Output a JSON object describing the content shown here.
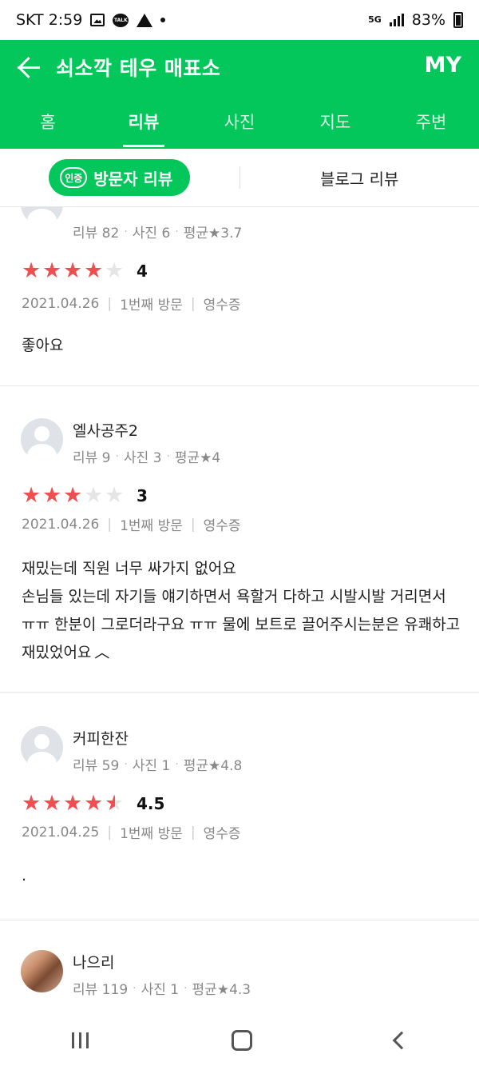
{
  "status": {
    "carrier_time": "SKT 2:59",
    "network": "5G",
    "battery": "83%"
  },
  "appbar": {
    "title": "쇠소깍 테우 매표소",
    "my_label": "MY"
  },
  "tabs": [
    {
      "label": "홈"
    },
    {
      "label": "리뷰"
    },
    {
      "label": "사진"
    },
    {
      "label": "지도"
    },
    {
      "label": "주변"
    }
  ],
  "subtabs": {
    "badge": "인증",
    "visitor": "방문자 리뷰",
    "blog": "블로그 리뷰"
  },
  "reviews": [
    {
      "name": "",
      "meta": {
        "reviews": "리뷰 82",
        "photos": "사진 6",
        "avg": "평균★3.7"
      },
      "rating": 4,
      "score": "4",
      "visit": {
        "date": "2021.04.26",
        "count": "1번째 방문",
        "type": "영수증"
      },
      "content": "좋아요"
    },
    {
      "name": "엘사공주2",
      "meta": {
        "reviews": "리뷰 9",
        "photos": "사진 3",
        "avg": "평균★4"
      },
      "rating": 3,
      "score": "3",
      "visit": {
        "date": "2021.04.26",
        "count": "1번째 방문",
        "type": "영수증"
      },
      "content": "재밌는데 직원 너무 싸가지 없어요\n손님들 있는데 자기들 얘기하면서 욕할거 다하고 시발시발 거리면서 ㅠㅠ 한분이 그로더라구요 ㅠㅠ 물에 보트로 끌어주시는분은 유쾌하고 재밌었어요",
      "collapse_icon": "chevron-up-icon"
    },
    {
      "name": "커피한잔",
      "meta": {
        "reviews": "리뷰 59",
        "photos": "사진 1",
        "avg": "평균★4.8"
      },
      "rating": 4.5,
      "score": "4.5",
      "visit": {
        "date": "2021.04.25",
        "count": "1번째 방문",
        "type": "영수증"
      },
      "content": "."
    },
    {
      "name": "나으리",
      "meta": {
        "reviews": "리뷰 119",
        "photos": "사진 1",
        "avg": "평균★4.3"
      }
    }
  ],
  "colors": {
    "brand": "#03c75a",
    "star": "#f04f52"
  }
}
